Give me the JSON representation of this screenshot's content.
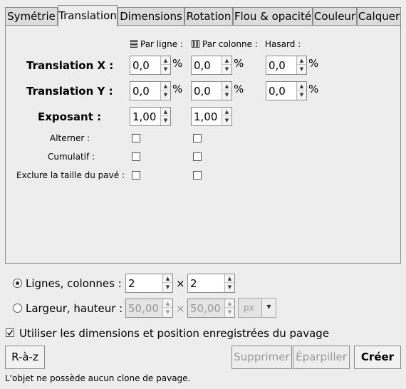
{
  "tabs": [
    {
      "label": "Symétrie"
    },
    {
      "label": "Translation"
    },
    {
      "label": "Dimensions"
    },
    {
      "label": "Rotation"
    },
    {
      "label": "Flou & opacité"
    },
    {
      "label": "Couleur"
    },
    {
      "label": "Calquer"
    }
  ],
  "active_tab": "Translation",
  "columns": {
    "per_row": "Par ligne :",
    "per_col": "Par colonne :",
    "random": "Hasard :"
  },
  "rows": {
    "translate_x": {
      "label": "Translation X :",
      "per_row": "0,0",
      "per_col": "0,0",
      "random": "0,0",
      "unit": "%"
    },
    "translate_y": {
      "label": "Translation Y :",
      "per_row": "0,0",
      "per_col": "0,0",
      "random": "0,0",
      "unit": "%"
    },
    "exponent": {
      "label": "Exposant :",
      "per_row": "1,00",
      "per_col": "1,00"
    }
  },
  "checks": {
    "alternate": "Alterner :",
    "cumulative": "Cumulatif :",
    "exclude": "Exclure la taille du pavé :"
  },
  "layout_opts": {
    "rows_cols_label": "Lignes, colonnes :",
    "rows": "2",
    "cols": "2",
    "times": "×",
    "wh_label": "Largeur, hauteur :",
    "width": "50,00",
    "height": "50,00",
    "unit": "px"
  },
  "use_saved": "Utiliser les dimensions et position enregistrées du pavage",
  "buttons": {
    "reset": "R-à-z",
    "delete": "Supprimer",
    "scatter": "Éparpiller",
    "create": "Créer"
  },
  "status": "L'objet ne possède aucun clone de pavage."
}
